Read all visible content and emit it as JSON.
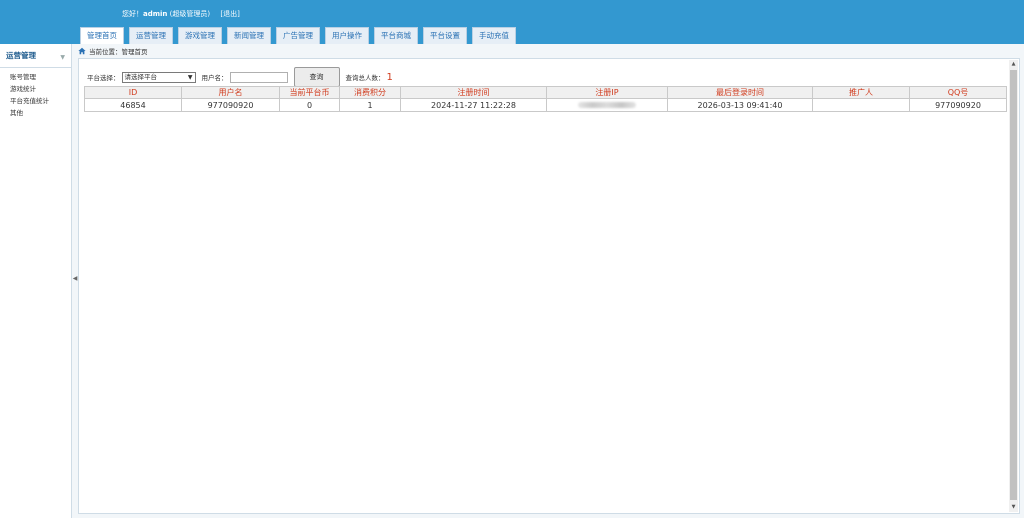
{
  "header": {
    "greeting_prefix": "您好！",
    "username": "admin",
    "role": "(超级管理员)",
    "logout": "[退出]"
  },
  "nav": {
    "tabs": [
      {
        "label": "管理首页"
      },
      {
        "label": "运营管理"
      },
      {
        "label": "游戏管理"
      },
      {
        "label": "新闻管理"
      },
      {
        "label": "广告管理"
      },
      {
        "label": "用户操作"
      },
      {
        "label": "平台商城"
      },
      {
        "label": "平台设置"
      },
      {
        "label": "手动充值"
      }
    ]
  },
  "sidebar": {
    "title": "运营管理",
    "items": [
      {
        "label": "账号管理"
      },
      {
        "label": "游戏统计"
      },
      {
        "label": "平台充值统计"
      },
      {
        "label": "其他"
      }
    ]
  },
  "breadcrumb": {
    "prefix": "当前位置：",
    "page": "管理首页"
  },
  "toolbar": {
    "platform_label": "平台选择：",
    "platform_selected": "请选择平台",
    "username_label": "用户名：",
    "username_value": "",
    "query_button": "查询",
    "count_label": "查询总人数：",
    "count_value": "1"
  },
  "table": {
    "headers": [
      "ID",
      "用户名",
      "当前平台币",
      "消费积分",
      "注册时间",
      "注册IP",
      "最后登录时间",
      "推广人",
      "QQ号"
    ],
    "rows": [
      [
        "46854",
        "977090920",
        "0",
        "1",
        "2024-11-27 11:22:28",
        "",
        "2026-03-13 09:41:40",
        "",
        "977090920"
      ]
    ]
  },
  "colors": {
    "header_bg": "#3398d0",
    "accent_red": "#d03a1c",
    "tab_text": "#2a71b4"
  }
}
